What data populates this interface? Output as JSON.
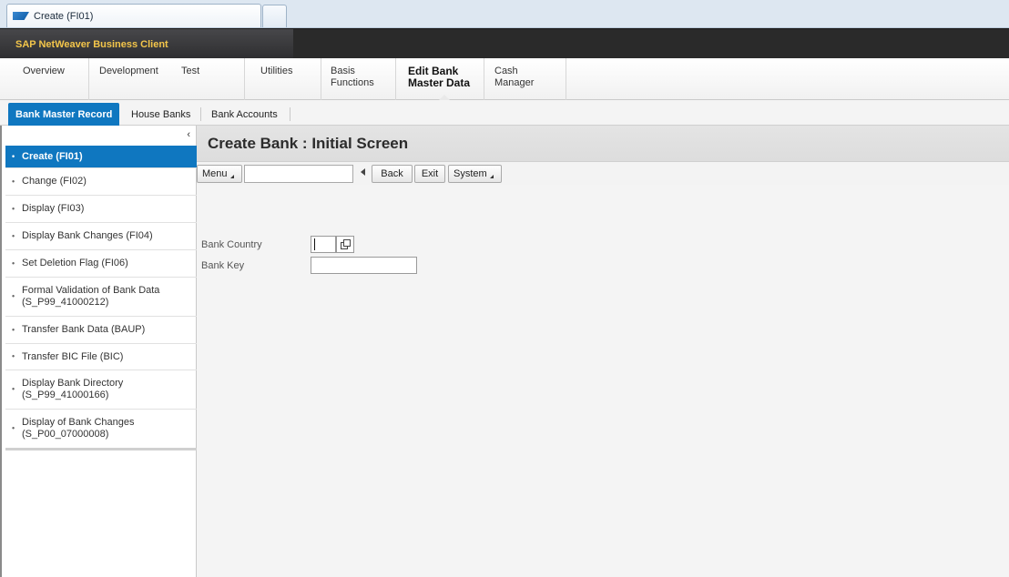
{
  "window": {
    "tab_title": "Create (FI01)",
    "brand": "SAP NetWeaver Business Client"
  },
  "launchpad": {
    "items": [
      {
        "label_line1": "Overview",
        "label_line2": ""
      },
      {
        "label_line1": "Development",
        "label_line2": ""
      },
      {
        "label_line1": "Test",
        "label_line2": ""
      },
      {
        "label_line1": "Utilities",
        "label_line2": ""
      },
      {
        "label_line1": "Basis",
        "label_line2": "Functions"
      },
      {
        "label_line1": "Edit Bank",
        "label_line2": "Master Data"
      },
      {
        "label_line1": "Cash",
        "label_line2": "Manager"
      }
    ],
    "active_index": 5
  },
  "work_center_tabs": [
    {
      "label": "Bank Master Record",
      "active": true
    },
    {
      "label": "House Banks",
      "active": false
    },
    {
      "label": "Bank Accounts",
      "active": false
    }
  ],
  "navigation": {
    "collapse_glyph": "‹",
    "items": [
      {
        "line1": "Create (FI01)",
        "line2": ""
      },
      {
        "line1": "Change (FI02)",
        "line2": ""
      },
      {
        "line1": "Display (FI03)",
        "line2": ""
      },
      {
        "line1": "Display Bank Changes (FI04)",
        "line2": ""
      },
      {
        "line1": "Set Deletion Flag (FI06)",
        "line2": ""
      },
      {
        "line1": "Formal Validation of Bank Data",
        "line2": "(S_P99_41000212)"
      },
      {
        "line1": "Transfer Bank Data (BAUP)",
        "line2": ""
      },
      {
        "line1": "Transfer BIC File (BIC)",
        "line2": ""
      },
      {
        "line1": "Display Bank Directory",
        "line2": "(S_P99_41000166)"
      },
      {
        "line1": "Display of Bank Changes",
        "line2": "(S_P00_07000008)"
      }
    ],
    "active_index": 0
  },
  "screen": {
    "title": "Create Bank : Initial Screen",
    "toolbar": {
      "menu_label": "Menu",
      "command_value": "",
      "back_label": "Back",
      "exit_label": "Exit",
      "system_label": "System"
    },
    "form": {
      "bank_country_label": "Bank Country",
      "bank_country_value": "",
      "bank_key_label": "Bank Key",
      "bank_key_value": ""
    }
  },
  "icons": {
    "tab_logo": "sap-logo-icon",
    "f4_help": "value-help-icon",
    "back": "back-arrow-icon",
    "collapse": "chevron-left-icon"
  },
  "colors": {
    "accent_blue": "#0f77c0",
    "brand_text": "#f4c64a",
    "title_bar": "#2b2b2b"
  }
}
